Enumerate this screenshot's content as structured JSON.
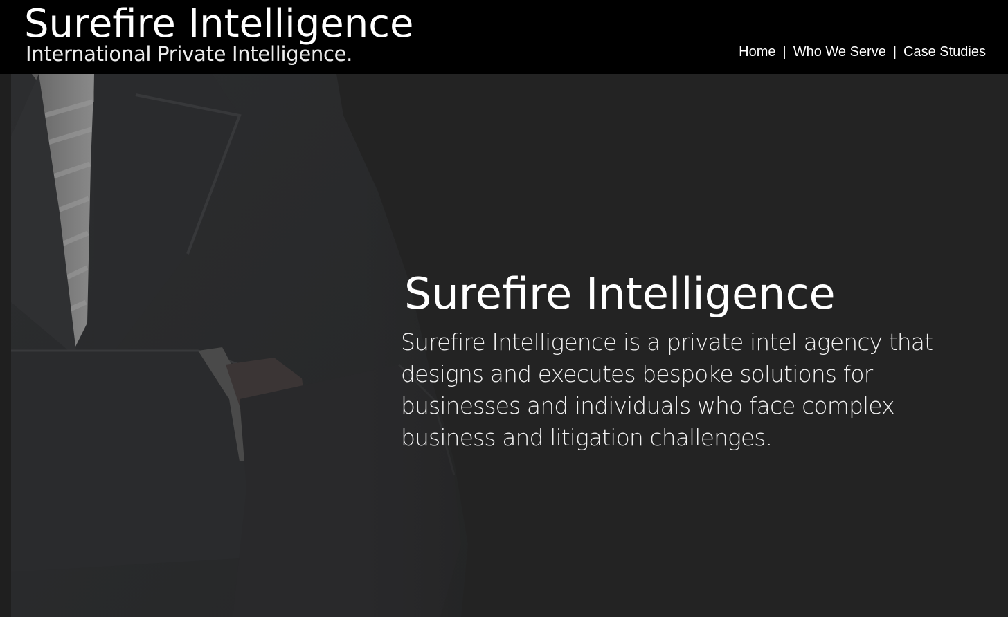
{
  "header": {
    "title": "Surefire Intelligence",
    "tagline": "International Private Intelligence.",
    "nav": [
      {
        "label": "Home"
      },
      {
        "label": "Who We Serve"
      },
      {
        "label": "Case Studies"
      }
    ],
    "nav_separator": "|"
  },
  "hero": {
    "heading": "Surefire Intelligence",
    "body": "Surefire Intelligence is a private intel agency that designs and executes bespoke solutions for businesses and individuals who face complex business and litigation challenges.",
    "image": "suit-crossed-arms-photo"
  },
  "colors": {
    "header_bg": "#000000",
    "hero_bg": "#232323",
    "text": "#ffffff"
  }
}
